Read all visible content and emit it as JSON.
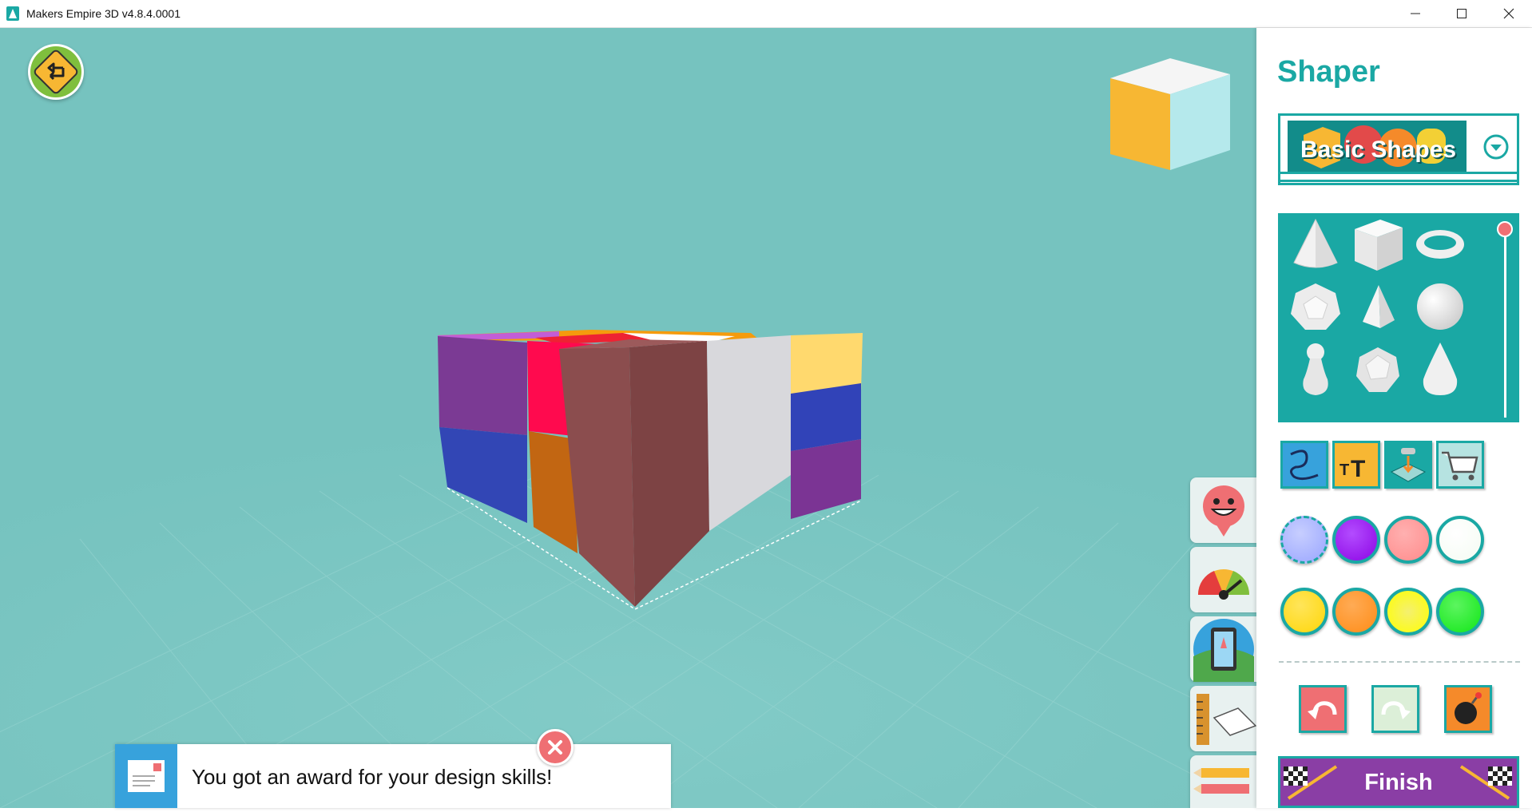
{
  "window": {
    "title": "Makers Empire 3D v4.8.4.0001"
  },
  "panel": {
    "title": "Shaper",
    "category": "Basic Shapes",
    "shapes": [
      "cone",
      "cube",
      "torus",
      "dodecahedron",
      "pyramid",
      "sphere",
      "pawn",
      "icosahedron",
      "teardrop"
    ],
    "tools": [
      "curve-tool",
      "text-tool",
      "import-tool",
      "shop-tool"
    ],
    "colors": [
      "#9aa6ff",
      "#8c05e4",
      "#ff8b8b",
      "#f4fbf2",
      "#ffd608",
      "#ff8c16",
      "#ffff00",
      "#12e618"
    ],
    "selected_color": "#9aa6ff",
    "actions": [
      "undo",
      "redo",
      "delete"
    ],
    "finish_label": "Finish"
  },
  "side_tabs": [
    "emoji-tool",
    "gauge-tool",
    "preview-tool",
    "measure-tool",
    "sketch-tool"
  ],
  "notification": {
    "text": "You got an award for your design skills!"
  }
}
